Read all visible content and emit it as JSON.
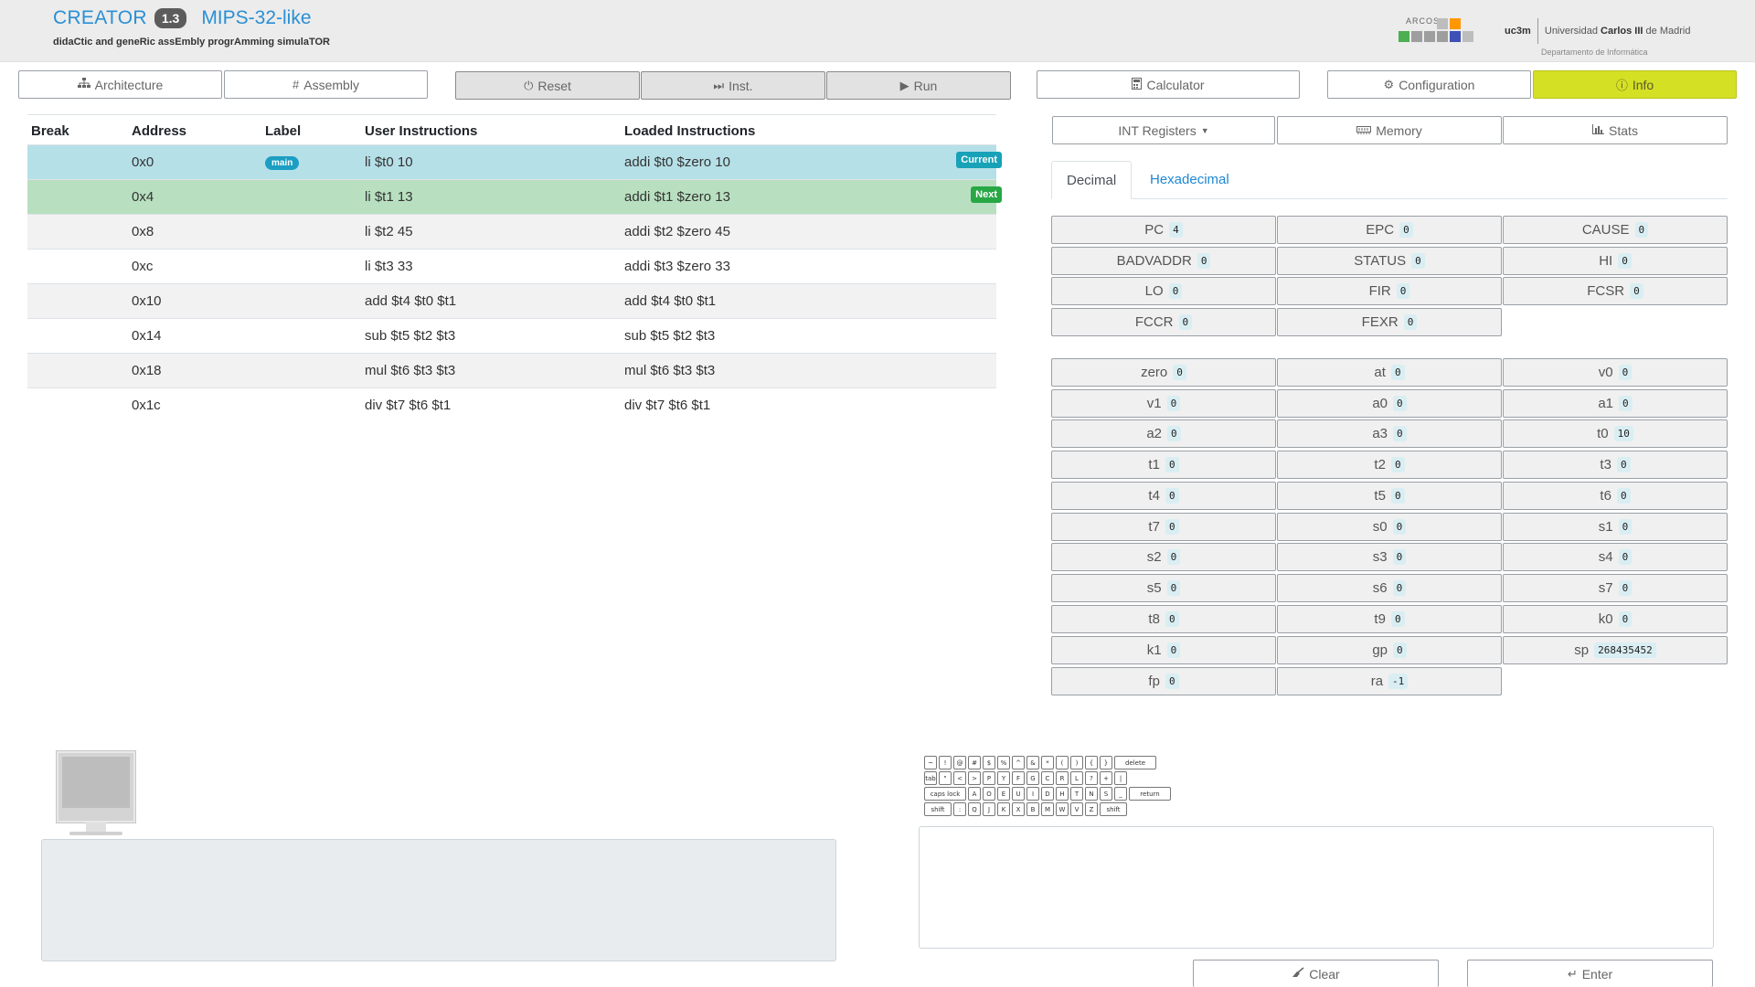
{
  "header": {
    "brand": "CREATOR",
    "version": "1.3",
    "architecture": "MIPS-32-like",
    "subtitle": "didaCtic and geneRic assEmbly progrAmming simulaTOR",
    "arcos_logo_text": "ARCOS",
    "uc3m_short": "uc3m",
    "university_prefix": "Universidad ",
    "university_bold": "Carlos III",
    "university_suffix": " de Madrid",
    "department": "Departamento de Informática"
  },
  "toolbar": {
    "architecture": "Architecture",
    "assembly": "Assembly",
    "reset": "Reset",
    "inst": "Inst.",
    "run": "Run",
    "calculator": "Calculator",
    "configuration": "Configuration",
    "info": "Info"
  },
  "instructions": {
    "headers": [
      "Break",
      "Address",
      "Label",
      "User Instructions",
      "Loaded Instructions"
    ],
    "rows": [
      {
        "address": "0x0",
        "label": "main",
        "user": "li $t0 10",
        "loaded": "addi $t0 $zero 10",
        "tag": "Current"
      },
      {
        "address": "0x4",
        "label": "",
        "user": "li $t1 13",
        "loaded": "addi $t1 $zero 13",
        "tag": "Next"
      },
      {
        "address": "0x8",
        "label": "",
        "user": "li $t2 45",
        "loaded": "addi $t2 $zero 45",
        "tag": ""
      },
      {
        "address": "0xc",
        "label": "",
        "user": "li $t3 33",
        "loaded": "addi $t3 $zero 33",
        "tag": ""
      },
      {
        "address": "0x10",
        "label": "",
        "user": "add $t4 $t0 $t1",
        "loaded": "add $t4 $t0 $t1",
        "tag": ""
      },
      {
        "address": "0x14",
        "label": "",
        "user": "sub $t5 $t2 $t3",
        "loaded": "sub $t5 $t2 $t3",
        "tag": ""
      },
      {
        "address": "0x18",
        "label": "",
        "user": "mul $t6 $t3 $t3",
        "loaded": "mul $t6 $t3 $t3",
        "tag": ""
      },
      {
        "address": "0x1c",
        "label": "",
        "user": "div $t7 $t6 $t1",
        "loaded": "div $t7 $t6 $t1",
        "tag": ""
      }
    ]
  },
  "data_view": {
    "int_registers": "INT Registers",
    "memory": "Memory",
    "stats": "Stats",
    "tab_decimal": "Decimal",
    "tab_hex": "Hexadecimal"
  },
  "control_registers": [
    {
      "name": "PC",
      "value": "4"
    },
    {
      "name": "EPC",
      "value": "0"
    },
    {
      "name": "CAUSE",
      "value": "0"
    },
    {
      "name": "BADVADDR",
      "value": "0"
    },
    {
      "name": "STATUS",
      "value": "0"
    },
    {
      "name": "HI",
      "value": "0"
    },
    {
      "name": "LO",
      "value": "0"
    },
    {
      "name": "FIR",
      "value": "0"
    },
    {
      "name": "FCSR",
      "value": "0"
    },
    {
      "name": "FCCR",
      "value": "0"
    },
    {
      "name": "FEXR",
      "value": "0"
    }
  ],
  "int_registers": [
    {
      "name": "zero",
      "value": "0"
    },
    {
      "name": "at",
      "value": "0"
    },
    {
      "name": "v0",
      "value": "0"
    },
    {
      "name": "v1",
      "value": "0"
    },
    {
      "name": "a0",
      "value": "0"
    },
    {
      "name": "a1",
      "value": "0"
    },
    {
      "name": "a2",
      "value": "0"
    },
    {
      "name": "a3",
      "value": "0"
    },
    {
      "name": "t0",
      "value": "10"
    },
    {
      "name": "t1",
      "value": "0"
    },
    {
      "name": "t2",
      "value": "0"
    },
    {
      "name": "t3",
      "value": "0"
    },
    {
      "name": "t4",
      "value": "0"
    },
    {
      "name": "t5",
      "value": "0"
    },
    {
      "name": "t6",
      "value": "0"
    },
    {
      "name": "t7",
      "value": "0"
    },
    {
      "name": "s0",
      "value": "0"
    },
    {
      "name": "s1",
      "value": "0"
    },
    {
      "name": "s2",
      "value": "0"
    },
    {
      "name": "s3",
      "value": "0"
    },
    {
      "name": "s4",
      "value": "0"
    },
    {
      "name": "s5",
      "value": "0"
    },
    {
      "name": "s6",
      "value": "0"
    },
    {
      "name": "s7",
      "value": "0"
    },
    {
      "name": "t8",
      "value": "0"
    },
    {
      "name": "t9",
      "value": "0"
    },
    {
      "name": "k0",
      "value": "0"
    },
    {
      "name": "k1",
      "value": "0"
    },
    {
      "name": "gp",
      "value": "0"
    },
    {
      "name": "sp",
      "value": "268435452"
    },
    {
      "name": "fp",
      "value": "0"
    },
    {
      "name": "ra",
      "value": "-1"
    }
  ],
  "io": {
    "clear": "Clear",
    "enter": "Enter"
  },
  "keyboard_rows": [
    [
      "~",
      "!",
      "@",
      "#",
      "$",
      "%",
      "^",
      "&",
      "*",
      "(",
      ")",
      "{",
      "}",
      "delete"
    ],
    [
      "tab",
      "\"",
      "<",
      ">",
      "P",
      "Y",
      "F",
      "G",
      "C",
      "R",
      "L",
      "?",
      "+",
      "|"
    ],
    [
      "caps lock",
      "A",
      "O",
      "E",
      "U",
      "I",
      "D",
      "H",
      "T",
      "N",
      "S",
      "_",
      "return"
    ],
    [
      "shift",
      ":",
      "Q",
      "J",
      "K",
      "X",
      "B",
      "M",
      "W",
      "V",
      "Z",
      "shift"
    ]
  ],
  "colors": {
    "accent": "#2a8fd4",
    "info_button": "#d4e024",
    "current_row": "#b6e0e8",
    "next_row": "#b8e0c0",
    "current_tag": "#17a2b8",
    "next_tag": "#28a745"
  }
}
